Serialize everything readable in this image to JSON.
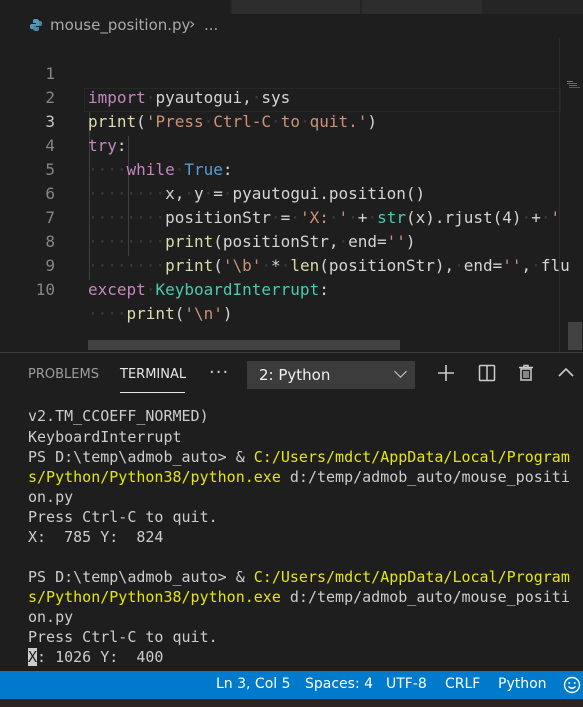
{
  "breadcrumb": {
    "file": "mouse_position.py",
    "separator": "›",
    "more": "..."
  },
  "editor": {
    "line_numbers": [
      "1",
      "2",
      "3",
      "4",
      "5",
      "6",
      "7",
      "8",
      "9",
      "10"
    ],
    "active_line": 3
  },
  "panel": {
    "tabs": [
      "PROBLEMS",
      "TERMINAL"
    ],
    "active_tab": "TERMINAL",
    "more": "···",
    "terminal_select": "2: Python",
    "actions": [
      "add-icon",
      "split-icon",
      "trash-icon",
      "chevron-up-icon"
    ]
  },
  "terminal": {
    "l1": "v2.TM_CCOEFF_NORMED)",
    "l2": "KeyboardInterrupt",
    "prompt1": "PS D:\\temp\\admob_auto> & ",
    "path1a": "C:/Users/mdct/AppData/Local/Program",
    "path1b": "s/Python/Python38/python.exe",
    "arg1a": " d:/temp/admob_auto/mouse_positi",
    "arg1b": "on.py",
    "quit1": "Press Ctrl-C to quit.",
    "pos1": "X:  785 Y:  824",
    "prompt2": "PS D:\\temp\\admob_auto> & ",
    "path2a": "C:/Users/mdct/AppData/Local/Program",
    "path2b": "s/Python/Python38/python.exe",
    "arg2a": " d:/temp/admob_auto/mouse_positi",
    "arg2b": "on.py",
    "quit2": "Press Ctrl-C to quit.",
    "pos2_cursor": "X",
    "pos2_rest": ": 1026 Y:  400"
  },
  "statusbar": {
    "position": "Ln 3, Col 5",
    "spaces": "Spaces: 4",
    "encoding": "UTF-8",
    "eol": "CRLF",
    "language": "Python",
    "feedback_icon": "smiley-icon"
  },
  "colors": {
    "keyword": "#c586c0",
    "function": "#dcdcaa",
    "string": "#ce9178",
    "builtin_const": "#569cd6",
    "class": "#4ec9b0",
    "status_bar": "#007acc",
    "terminal_path": "#e5e510"
  }
}
